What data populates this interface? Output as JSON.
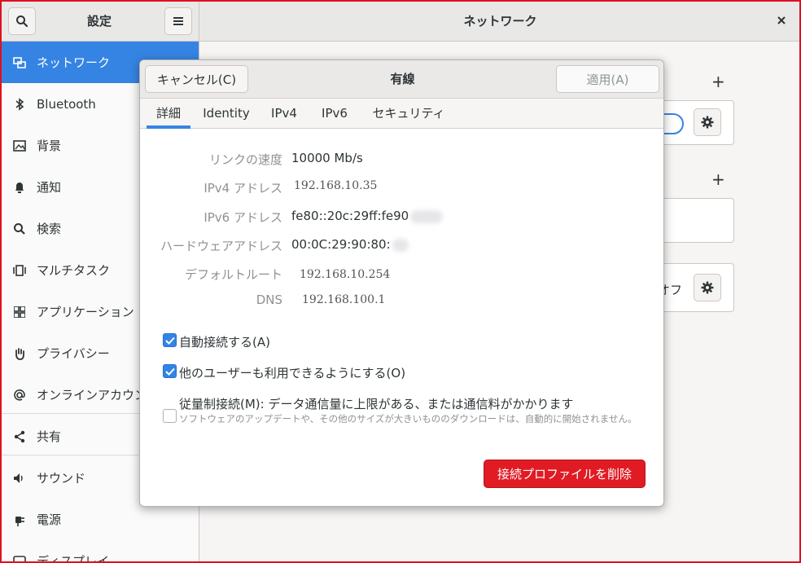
{
  "app": {
    "sidebar_title": "設定",
    "main_title": "ネットワーク"
  },
  "sidebar": {
    "items": [
      {
        "label": "ネットワーク",
        "icon": "network-icon"
      },
      {
        "label": "Bluetooth",
        "icon": "bluetooth-icon"
      },
      {
        "label": "背景",
        "icon": "background-icon"
      },
      {
        "label": "通知",
        "icon": "bell-icon"
      },
      {
        "label": "検索",
        "icon": "search-icon"
      },
      {
        "label": "マルチタスク",
        "icon": "multitasking-icon"
      },
      {
        "label": "アプリケーション",
        "icon": "apps-grid-icon"
      },
      {
        "label": "プライバシー",
        "icon": "hand-icon"
      },
      {
        "label": "オンラインアカウント",
        "icon": "at-icon"
      },
      {
        "label": "共有",
        "icon": "share-icon"
      },
      {
        "label": "サウンド",
        "icon": "speaker-icon"
      },
      {
        "label": "電源",
        "icon": "power-plug-icon"
      },
      {
        "label": "ディスプレイ",
        "icon": "display-icon"
      }
    ]
  },
  "background": {
    "vpn_status_fragment": "オフ"
  },
  "dialog": {
    "cancel_label": "キャンセル(C)",
    "title": "有線",
    "apply_label": "適用(A)",
    "tabs": [
      "詳細",
      "Identity",
      "IPv4",
      "IPv6",
      "セキュリティ"
    ],
    "details": [
      {
        "label": "リンクの速度",
        "value": "10000 Mb/s"
      },
      {
        "label": "IPv4 アドレス",
        "value": "192.168.10.35"
      },
      {
        "label": "IPv6 アドレス",
        "value": "fe80::20c:29ff:fe90"
      },
      {
        "label": "ハードウェアアドレス",
        "value": "00:0C:29:90:80:"
      },
      {
        "label": "デフォルトルート",
        "value": "192.168.10.254"
      },
      {
        "label": "DNS",
        "value": "192.168.100.1"
      }
    ],
    "auto_connect_label": "自動接続する(A)",
    "all_users_label": "他のユーザーも利用できるようにする(O)",
    "metered_label": "従量制接続(M): データ通信量に上限がある、または通信料がかかります",
    "metered_desc": "ソフトウェアのアップデートや、その他のサイズが大きいもののダウンロードは、自動的に開始されません。",
    "delete_label": "接続プロファイルを削除"
  },
  "colors": {
    "accent": "#3584e4",
    "destructive": "#e01b24",
    "frame": "#e0101f"
  }
}
